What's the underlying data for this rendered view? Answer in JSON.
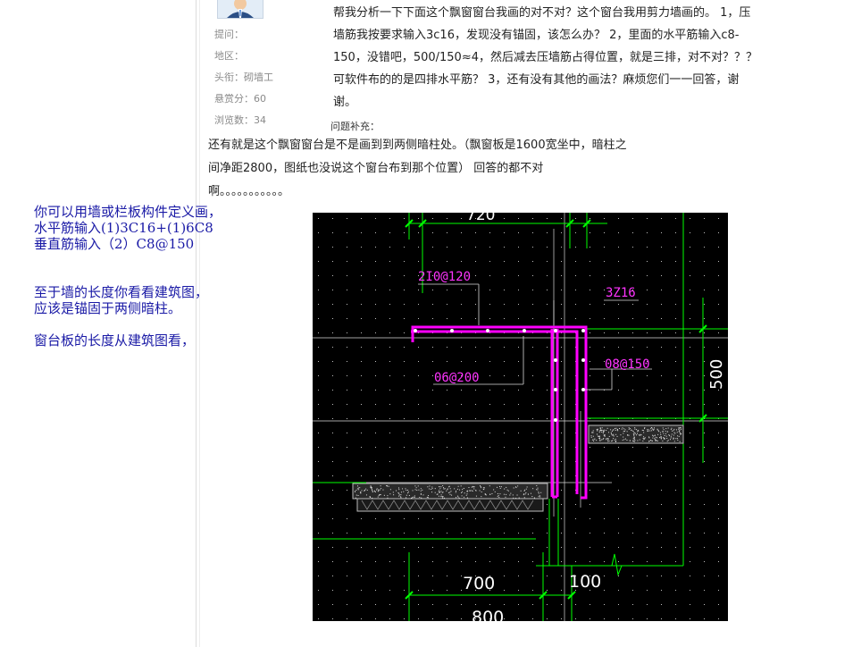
{
  "meta": {
    "asker_label": "提问：",
    "region_label": "地区：",
    "title_label": "头衔：",
    "title_value": "砌墙工",
    "bounty_label": "悬赏分：",
    "bounty_value": "60",
    "views_label": "浏览数：",
    "views_value": "34"
  },
  "question": {
    "lines": [
      "帮我分析一下下面这个飘窗窗台我画的对不对？这个窗台我用剪力墙画的。 1，压",
      "墙筋我按要求输入3c16，发现没有锚固，该怎么办？ 2，里面的水平筋输入c8-",
      "150，没错吧，500/150≈4，然后减去压墙筋占得位置，就是三排，对不对？？？",
      "可软件布的的是四排水平筋？ 3，还有没有其他的画法？麻烦您们一一回答，谢",
      "谢。"
    ],
    "supplement_label": "问题补充：",
    "supplement_lines": [
      "还有就是这个飘窗窗台是不是画到到两侧暗柱处。（飘窗板是1600宽坐中，暗柱之",
      "间净距2800，图纸也没说这个窗台布到那个位置） 回答的都不对",
      "啊。。。。。。。。。。。"
    ]
  },
  "answer": {
    "lines": [
      "你可以用墙或栏板构件定义画，",
      "水平筋输入(1)3C16+(1)6C8",
      "垂直筋输入（2）C8@150",
      "至于墙的长度你看看建筑图，",
      "应该是锚固于两侧暗柱。",
      "窗台板的长度从建筑图看，"
    ]
  },
  "drawing": {
    "labels": {
      "top_dim": "720",
      "rebar_top": "2I0@120",
      "rebar_main": "3Z16",
      "rebar_horiz": "06@200",
      "rebar_stirrup": "08@150",
      "height_dim": "500",
      "bottom_dim_a": "700",
      "bottom_dim_b": "100",
      "bottom_dim_total": "800"
    },
    "colors": {
      "background": "#000000",
      "rebar": "#ff00ff",
      "label": "#ff33ff",
      "dimension": "#00ff00",
      "grid_dot": "#ffffff"
    }
  }
}
